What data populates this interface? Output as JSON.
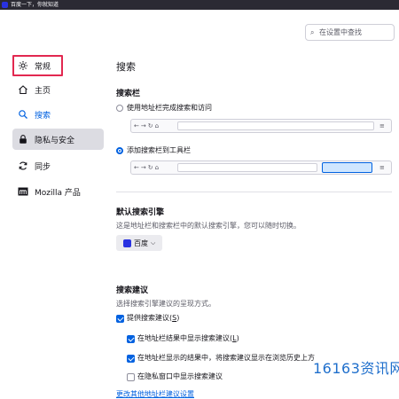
{
  "window": {
    "tab_title": "百度一下，你就知道",
    "favicon": "baidu-favicon"
  },
  "search": {
    "placeholder": "在设置中查找",
    "icon": "search-icon"
  },
  "sidebar": {
    "items": [
      {
        "label": "常规",
        "icon": "gear-icon",
        "selected": true
      },
      {
        "label": "主页",
        "icon": "home-icon"
      },
      {
        "label": "搜索",
        "icon": "search-icon"
      },
      {
        "label": "隐私与安全",
        "icon": "lock-icon"
      },
      {
        "label": "同步",
        "icon": "sync-icon"
      },
      {
        "label": "Mozilla 产品",
        "icon": "mozilla-icon"
      }
    ]
  },
  "page": {
    "title": "搜索"
  },
  "search_bar": {
    "heading": "搜索栏",
    "option_urlbar": "使用地址栏完成搜索和访问",
    "option_toolbar": "添加搜索栏到工具栏",
    "selected": "option_toolbar"
  },
  "default_engine": {
    "heading": "默认搜索引擎",
    "description": "这是地址栏和搜索栏中的默认搜索引擎，您可以随时切换。",
    "selected_engine": "百度"
  },
  "suggestions": {
    "heading": "搜索建议",
    "description": "选择搜索引擎建议的呈现方式。",
    "provide": {
      "label": "提供搜索建议(",
      "key": "S",
      "tail": ")",
      "checked": true
    },
    "show_in_urlbar": {
      "label": "在地址栏结果中显示搜索建议(",
      "key": "L",
      "tail": ")",
      "checked": true
    },
    "show_before_history": {
      "label": "在地址栏显示的结果中，将搜索建议显示在浏览历史上方",
      "checked": true
    },
    "show_in_private": {
      "label": "在隐私窗口中显示搜索建议",
      "checked": false
    },
    "more_link": "更改其他地址栏建议设置"
  },
  "watermark": "16163资讯网",
  "colors": {
    "accent": "#0061e0",
    "highlight_box": "#e22850",
    "titlebar": "#2b2a33"
  }
}
